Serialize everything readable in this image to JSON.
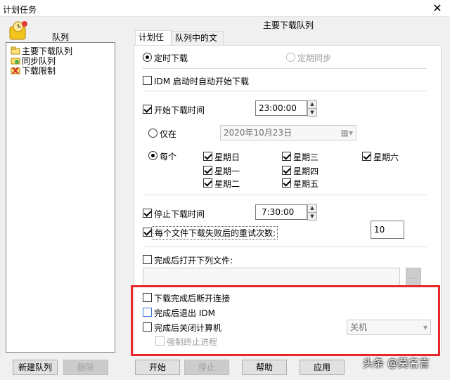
{
  "window": {
    "title": "计划任务",
    "close_glyph": "✕"
  },
  "left": {
    "label": "队列",
    "queues": [
      {
        "label": "主要下载队列",
        "icon": "main-queue-icon"
      },
      {
        "label": "同步队列",
        "icon": "sync-queue-icon"
      },
      {
        "label": "下载限制",
        "icon": "download-limit-icon"
      }
    ],
    "new_queue": "新建队列",
    "delete": "删除"
  },
  "main": {
    "title": "主要下载队列",
    "tabs": [
      {
        "label": "计划任务"
      },
      {
        "label": "队列中的文件"
      }
    ],
    "timed_download": "定时下载",
    "periodic_sync": "定期同步",
    "idm_start": "IDM 启动时自动开始下载",
    "start_time_label": "开始下载时间",
    "start_time_value": "23:00:00",
    "once_label": "仅在",
    "once_date": "2020年10月23日",
    "daily_label": "每个",
    "days": [
      "星期日",
      "星期一",
      "星期二",
      "星期三",
      "星期四",
      "星期五",
      "星期六"
    ],
    "stop_time_label": "停止下载时间",
    "stop_time_value": "7:30:00",
    "retry_label": "每个文件下载失败后的重试次数:",
    "retry_value": "10",
    "open_file_label": "完成后打开下列文件:",
    "browse": "...",
    "disconnect": "下载完成后断开连接",
    "exit_idm": "完成后退出 IDM",
    "shutdown": "完成后关闭计算机",
    "shutdown_mode": "关机",
    "force_kill": "强制终止进程"
  },
  "buttons": {
    "start": "开始",
    "stop": "停止",
    "help": "帮助",
    "apply": "应用"
  },
  "watermark": "头条 @莫名言"
}
